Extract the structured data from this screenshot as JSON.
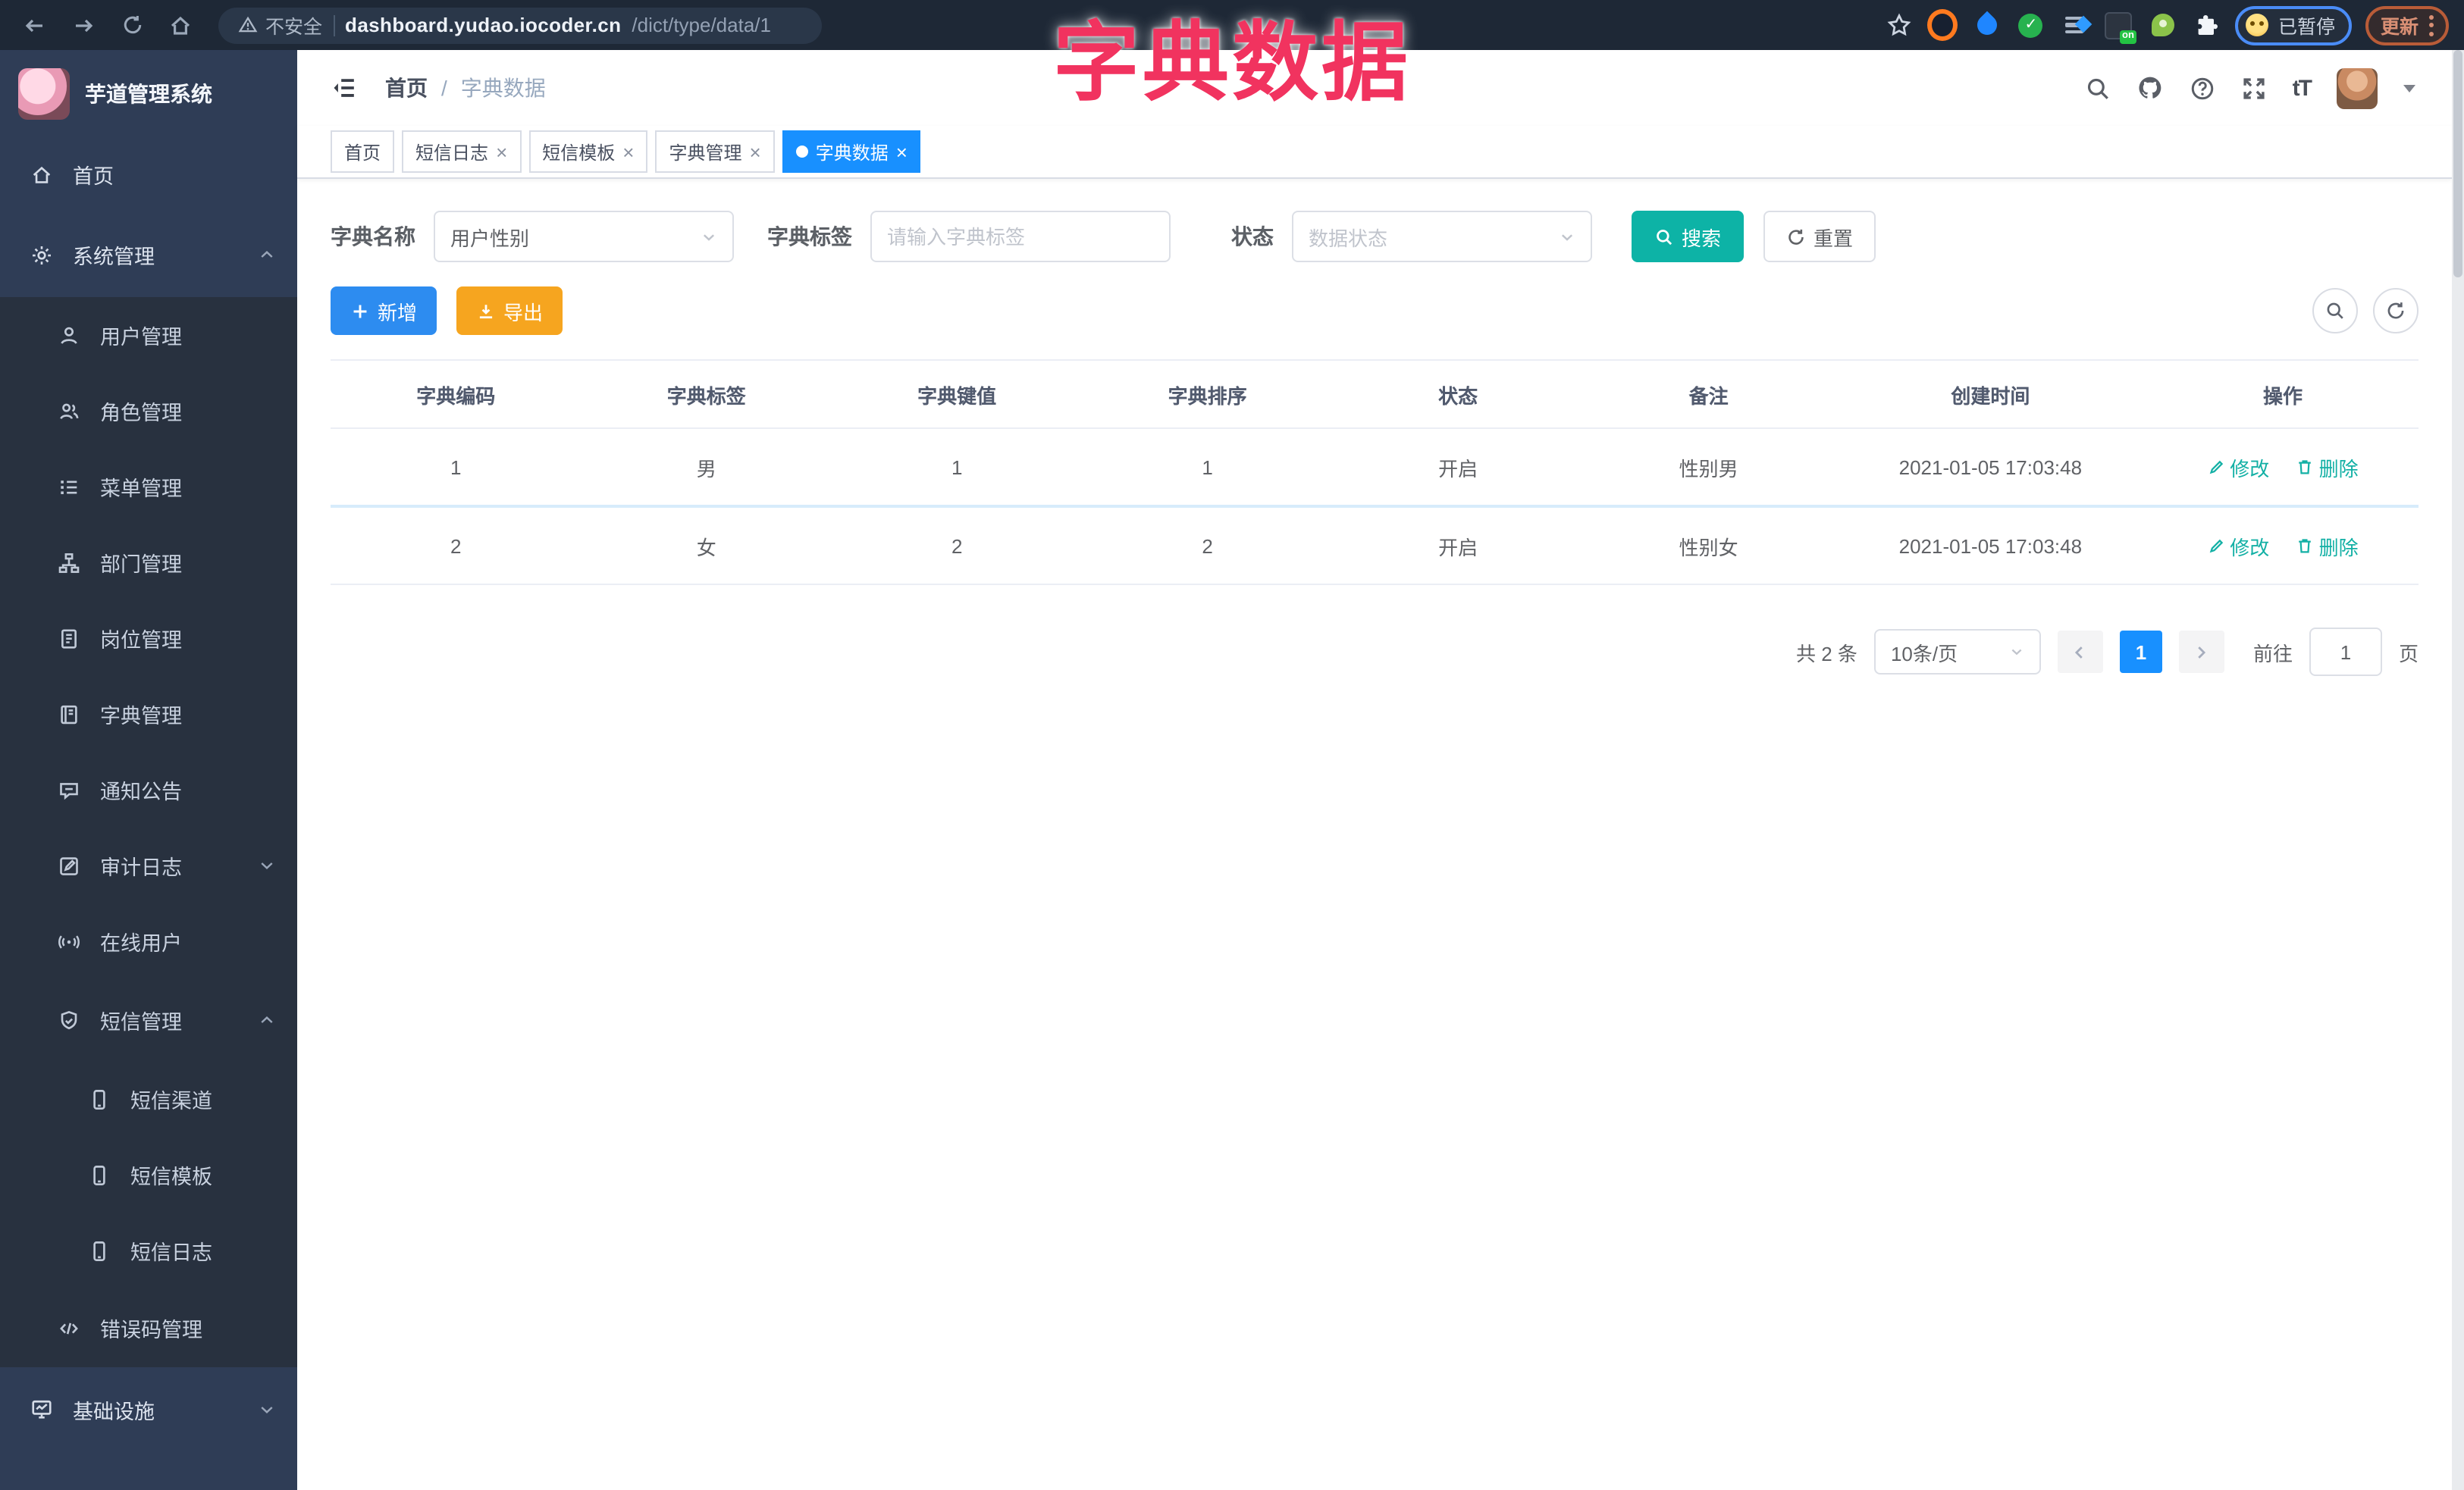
{
  "browser": {
    "security_label": "不安全",
    "url_host": "dashboard.yudao.iocoder.cn",
    "url_path": "/dict/type/data/1",
    "paused_badge": "已暂停",
    "update_button": "更新",
    "on_badge": "on"
  },
  "overlay_title": "字典数据",
  "sidebar": {
    "app_title": "芋道管理系统",
    "items": [
      {
        "label": "首页"
      },
      {
        "label": "系统管理"
      },
      {
        "label": "用户管理"
      },
      {
        "label": "角色管理"
      },
      {
        "label": "菜单管理"
      },
      {
        "label": "部门管理"
      },
      {
        "label": "岗位管理"
      },
      {
        "label": "字典管理"
      },
      {
        "label": "通知公告"
      },
      {
        "label": "审计日志"
      },
      {
        "label": "在线用户"
      },
      {
        "label": "短信管理"
      },
      {
        "label": "短信渠道"
      },
      {
        "label": "短信模板"
      },
      {
        "label": "短信日志"
      },
      {
        "label": "错误码管理"
      },
      {
        "label": "基础设施"
      }
    ]
  },
  "header": {
    "breadcrumb_home": "首页",
    "breadcrumb_sep": "/",
    "breadcrumb_current": "字典数据"
  },
  "tabs": [
    {
      "label": "首页"
    },
    {
      "label": "短信日志"
    },
    {
      "label": "短信模板"
    },
    {
      "label": "字典管理"
    },
    {
      "label": "字典数据"
    }
  ],
  "filters": {
    "dict_name_label": "字典名称",
    "dict_name_value": "用户性别",
    "dict_label_label": "字典标签",
    "dict_label_placeholder": "请输入字典标签",
    "status_label": "状态",
    "status_placeholder": "数据状态",
    "search_button": "搜索",
    "reset_button": "重置"
  },
  "toolbar": {
    "add_button": "新增",
    "export_button": "导出"
  },
  "table": {
    "columns": [
      "字典编码",
      "字典标签",
      "字典键值",
      "字典排序",
      "状态",
      "备注",
      "创建时间",
      "操作"
    ],
    "rows": [
      {
        "code": "1",
        "label": "男",
        "value": "1",
        "sort": "1",
        "status": "开启",
        "remark": "性别男",
        "created": "2021-01-05 17:03:48",
        "edit": "修改",
        "delete": "删除"
      },
      {
        "code": "2",
        "label": "女",
        "value": "2",
        "sort": "2",
        "status": "开启",
        "remark": "性别女",
        "created": "2021-01-05 17:03:48",
        "edit": "修改",
        "delete": "删除"
      }
    ]
  },
  "pagination": {
    "total": "共 2 条",
    "page_size": "10条/页",
    "current_page": "1",
    "goto_label": "前往",
    "goto_value": "1",
    "goto_suffix": "页"
  },
  "colors": {
    "accent_blue": "#1890ff",
    "teal": "#0db3a6",
    "warning_orange": "#f6a51f",
    "sidebar_dark": "#28313f",
    "sidebar_light": "#2f3d56",
    "title_pink": "#f1335f"
  }
}
